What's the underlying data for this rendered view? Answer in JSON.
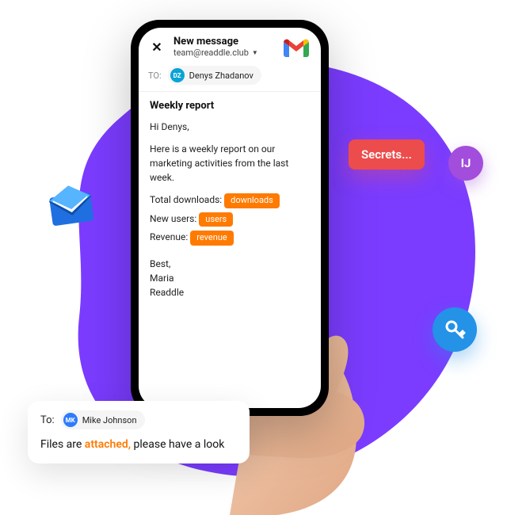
{
  "compose": {
    "title": "New message",
    "from": "team@readdle.club",
    "to_label": "TO:",
    "recipient": {
      "initials": "DZ",
      "name": "Denys Zhadanov"
    },
    "subject": "Weekly report",
    "greeting": "Hi Denys,",
    "intro": "Here is a weekly report on our marketing activities from the last week.",
    "metrics": [
      {
        "label": "Total downloads:",
        "tag": "downloads"
      },
      {
        "label": "New users:",
        "tag": "users"
      },
      {
        "label": "Revenue:",
        "tag": "revenue"
      }
    ],
    "closing": "Best,",
    "signature_name": "Maria",
    "signature_company": "Readdle"
  },
  "badges": {
    "secrets": "Secrets...",
    "avatar_ij": "IJ"
  },
  "mini": {
    "to_label": "To:",
    "recipient": {
      "initials": "MK",
      "name": "Mike Johnson"
    },
    "line_a": "Files are ",
    "accent": "attached,",
    "line_b": " please have a look"
  }
}
